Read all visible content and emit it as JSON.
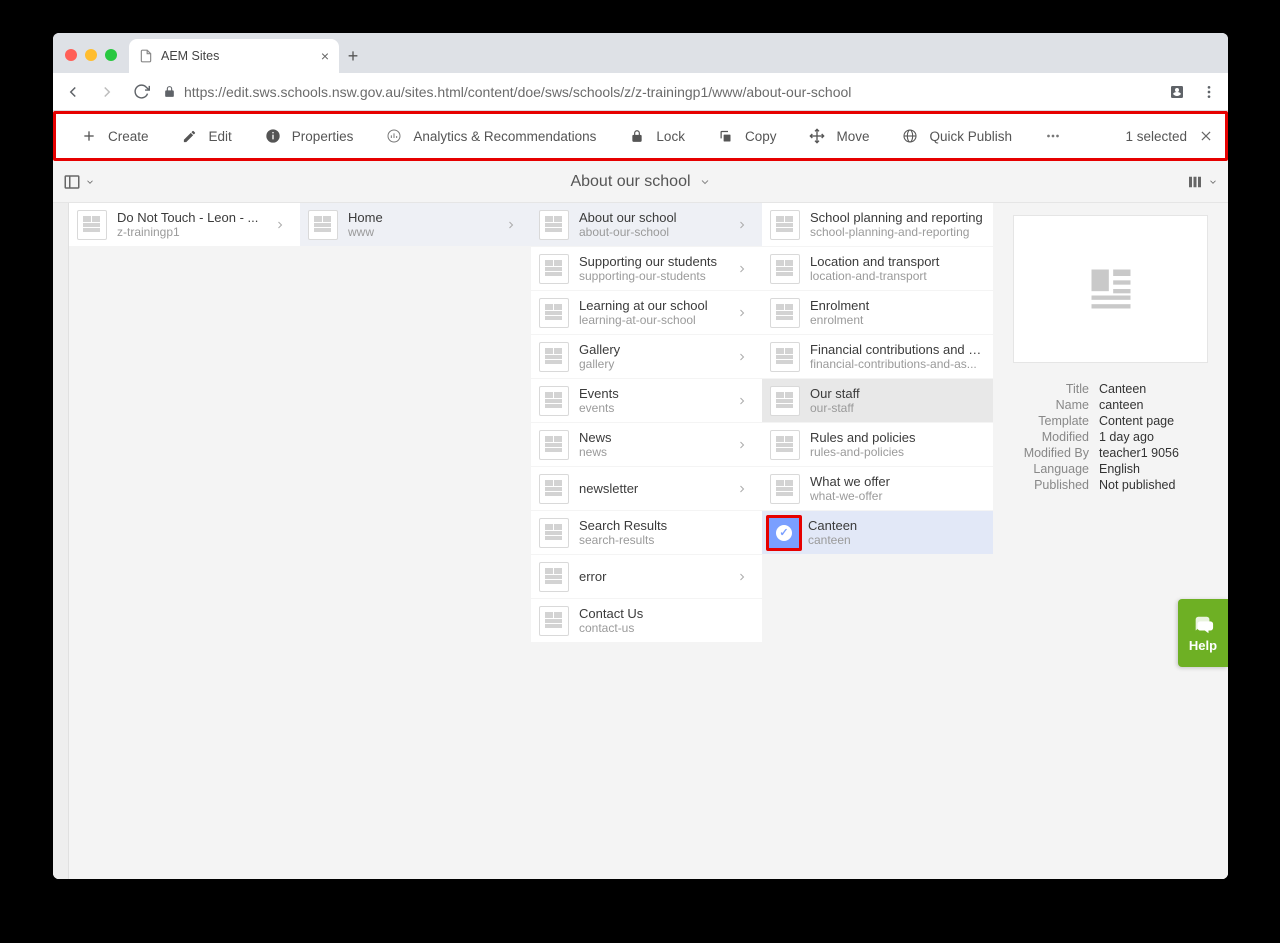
{
  "browser": {
    "tab_title": "AEM Sites",
    "url_host": "https://edit.sws.schools.nsw.gov.au",
    "url_path": "/sites.html/content/doe/sws/schools/z/z-trainingp1/www/about-our-school"
  },
  "actionbar": {
    "create": "Create",
    "edit": "Edit",
    "properties": "Properties",
    "analytics": "Analytics & Recommendations",
    "lock": "Lock",
    "copy": "Copy",
    "move": "Move",
    "quick_publish": "Quick Publish",
    "selected_text": "1 selected"
  },
  "secondary": {
    "title": "About our school"
  },
  "columns": [
    {
      "id": "col0",
      "rows": [
        {
          "title": "Do Not Touch - Leon - ...",
          "sub": "z-trainingp1",
          "hasChildren": true,
          "active": false
        }
      ]
    },
    {
      "id": "col1",
      "rows": [
        {
          "title": "Home",
          "sub": "www",
          "hasChildren": true,
          "active": true
        }
      ]
    },
    {
      "id": "col2",
      "rows": [
        {
          "title": "About our school",
          "sub": "about-our-school",
          "hasChildren": true,
          "active": true
        },
        {
          "title": "Supporting our students",
          "sub": "supporting-our-students",
          "hasChildren": true
        },
        {
          "title": "Learning at our school",
          "sub": "learning-at-our-school",
          "hasChildren": true
        },
        {
          "title": "Gallery",
          "sub": "gallery",
          "hasChildren": true
        },
        {
          "title": "Events",
          "sub": "events",
          "hasChildren": true
        },
        {
          "title": "News",
          "sub": "news",
          "hasChildren": true
        },
        {
          "title": "newsletter",
          "sub": "",
          "hasChildren": true
        },
        {
          "title": "Search Results",
          "sub": "search-results",
          "hasChildren": false
        },
        {
          "title": "error",
          "sub": "",
          "hasChildren": true
        },
        {
          "title": "Contact Us",
          "sub": "contact-us",
          "hasChildren": false
        }
      ]
    },
    {
      "id": "col3",
      "rows": [
        {
          "title": "School planning and reporting",
          "sub": "school-planning-and-reporting",
          "hasChildren": false
        },
        {
          "title": "Location and transport",
          "sub": "location-and-transport",
          "hasChildren": false
        },
        {
          "title": "Enrolment",
          "sub": "enrolment",
          "hasChildren": false
        },
        {
          "title": "Financial contributions and as...",
          "sub": "financial-contributions-and-as...",
          "hasChildren": false
        },
        {
          "title": "Our staff",
          "sub": "our-staff",
          "hasChildren": false,
          "highlight": true
        },
        {
          "title": "Rules and policies",
          "sub": "rules-and-policies",
          "hasChildren": false
        },
        {
          "title": "What we offer",
          "sub": "what-we-offer",
          "hasChildren": false
        },
        {
          "title": "Canteen",
          "sub": "canteen",
          "hasChildren": false,
          "selected": true
        }
      ]
    }
  ],
  "detail": {
    "fields": [
      {
        "label": "Title",
        "value": "Canteen"
      },
      {
        "label": "Name",
        "value": "canteen"
      },
      {
        "label": "Template",
        "value": "Content page"
      },
      {
        "label": "Modified",
        "value": "1 day ago"
      },
      {
        "label": "Modified By",
        "value": "teacher1 9056"
      },
      {
        "label": "Language",
        "value": "English"
      },
      {
        "label": "Published",
        "value": "Not published"
      }
    ]
  },
  "help": {
    "label": "Help"
  }
}
